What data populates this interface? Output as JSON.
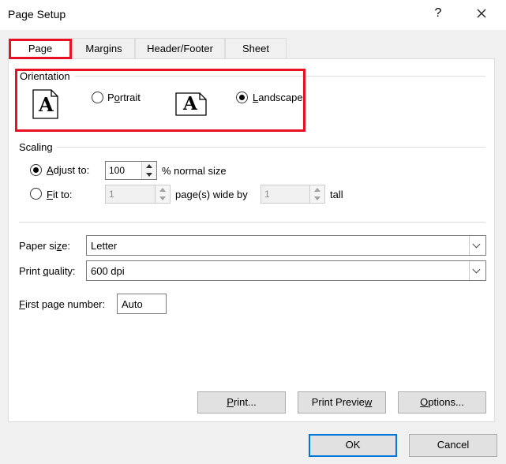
{
  "window": {
    "title": "Page Setup",
    "help_glyph": "?",
    "close_glyph": "×"
  },
  "tabs": [
    {
      "label": "Page",
      "active": true
    },
    {
      "label": "Margins",
      "active": false
    },
    {
      "label": "Header/Footer",
      "active": false
    },
    {
      "label": "Sheet",
      "active": false
    }
  ],
  "orientation": {
    "heading": "Orientation",
    "portrait": {
      "pre": "P",
      "accel": "o",
      "post": "rtrait",
      "selected": false,
      "icon": "portrait-page-icon",
      "glyph": "A"
    },
    "landscape": {
      "pre": "",
      "accel": "L",
      "post": "andscape",
      "selected": true,
      "icon": "landscape-page-icon",
      "glyph": "A"
    }
  },
  "scaling": {
    "heading": "Scaling",
    "adjust": {
      "pre": "",
      "accel": "A",
      "post": "djust to:",
      "value": "100",
      "suffix": "% normal size",
      "selected": true
    },
    "fit": {
      "pre": "",
      "accel": "F",
      "post": "it to:",
      "wide_value": "1",
      "wide_label": "page(s) wide by",
      "tall_value": "1",
      "tall_label": "tall",
      "selected": false
    }
  },
  "paper_size": {
    "pre": "Paper si",
    "accel": "z",
    "post": "e:",
    "value": "Letter"
  },
  "print_quality": {
    "pre": "Print ",
    "accel": "q",
    "post": "uality:",
    "value": "600 dpi"
  },
  "first_page": {
    "pre": "",
    "accel": "F",
    "post": "irst page number:",
    "value": "Auto"
  },
  "buttons": {
    "print": {
      "pre": "",
      "accel": "P",
      "post": "rint..."
    },
    "preview": {
      "pre": "Print Previe",
      "accel": "w",
      "post": ""
    },
    "options": {
      "pre": "",
      "accel": "O",
      "post": "ptions..."
    },
    "ok": "OK",
    "cancel": "Cancel"
  },
  "colors": {
    "highlight": "#e81123",
    "focus": "#0078d7",
    "panel": "#ffffff",
    "chrome": "#f0f0f0"
  }
}
